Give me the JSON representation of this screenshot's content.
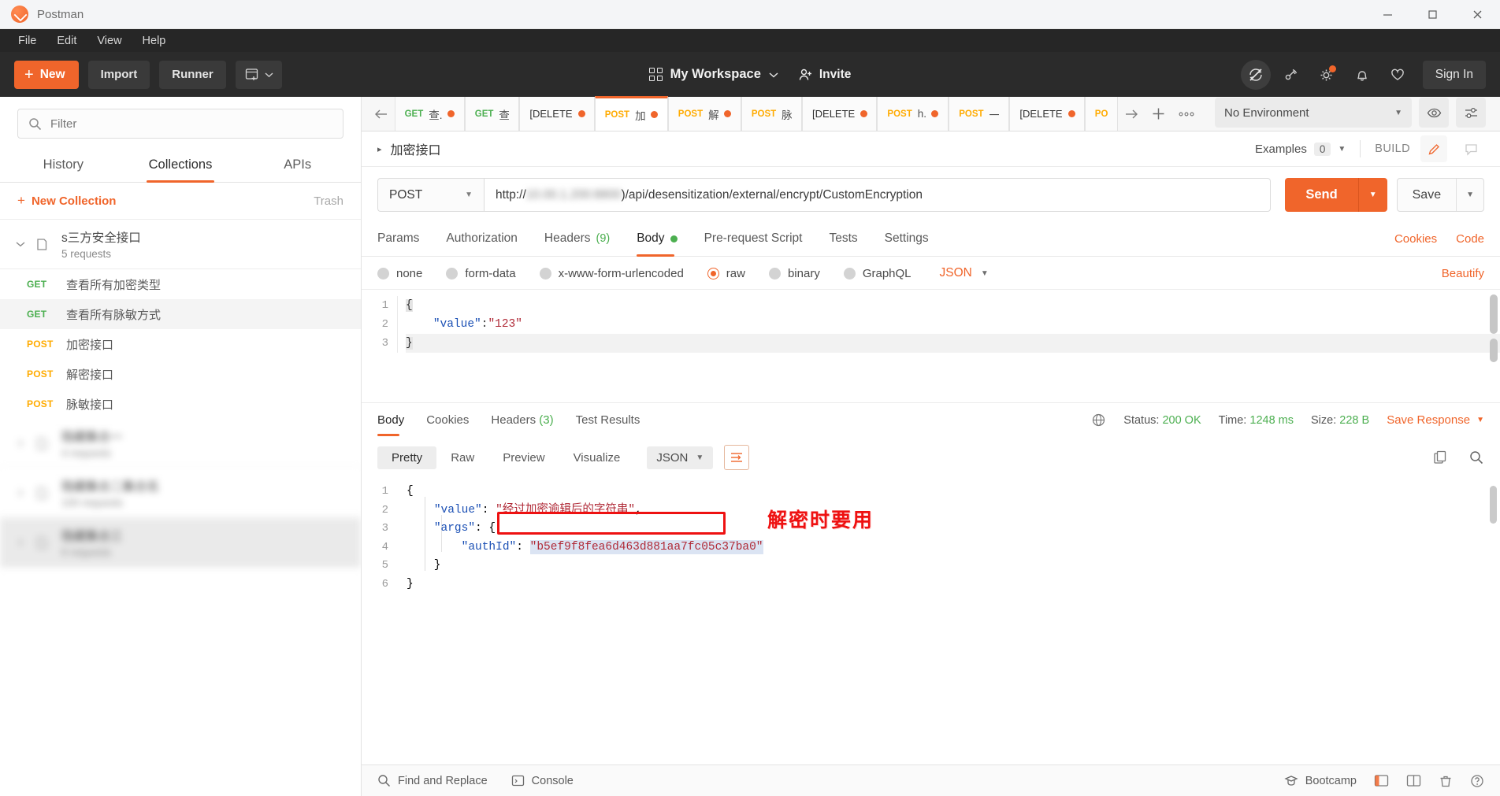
{
  "window": {
    "title": "Postman",
    "logo_icon": "postman-logo-icon",
    "minimize_label": "—",
    "maximize_label": "❐",
    "close_label": "✕"
  },
  "menubar": {
    "items": [
      "File",
      "Edit",
      "View",
      "Help"
    ]
  },
  "toolbar": {
    "new_label": "New",
    "new_plus": "+",
    "import_label": "Import",
    "runner_label": "Runner",
    "new_window_icon": "new-window-icon",
    "workspace_label": "My Workspace",
    "workspace_icon": "grid-icon",
    "invite_label": "Invite",
    "invite_icon": "person-add-icon",
    "sync_icon": "sync-off-icon",
    "satellite_icon": "satellite-icon",
    "gear_icon": "gear-icon",
    "bell_icon": "bell-icon",
    "heart_icon": "heart-icon",
    "signin_label": "Sign In",
    "accent": "#f0652b"
  },
  "sidebar": {
    "search": {
      "placeholder": "Filter",
      "value": "",
      "icon": "search-icon"
    },
    "tabs": [
      {
        "label": "History",
        "active": false
      },
      {
        "label": "Collections",
        "active": true
      },
      {
        "label": "APIs",
        "active": false
      }
    ],
    "new_collection_label": "New Collection",
    "new_collection_plus": "+",
    "trash_label": "Trash",
    "collection": {
      "name": "s三方安全接口",
      "sub": "5 requests",
      "chevron": "⌄",
      "folder_icon": "folder-icon"
    },
    "requests": [
      {
        "method": "GET",
        "name": "查看所有加密类型",
        "selected": false
      },
      {
        "method": "GET",
        "name": "查看所有脉敏方式",
        "selected": true
      },
      {
        "method": "POST",
        "name": "加密接口",
        "selected": false
      },
      {
        "method": "POST",
        "name": "解密接口",
        "selected": false
      },
      {
        "method": "POST",
        "name": "脉敏接口",
        "selected": false
      }
    ],
    "hidden_collections": [
      {
        "name": "隐藏集合一",
        "sub": "4 requests",
        "shaded": false
      },
      {
        "name": "隐藏集合二集合名",
        "sub": "100 requests",
        "shaded": false
      },
      {
        "name": "隐藏集合三",
        "sub": "6 requests",
        "shaded": true
      }
    ]
  },
  "tabstrip": {
    "scroll_left_icon": "arrow-left-icon",
    "scroll_right_icon": "arrow-right-icon",
    "add_tab_icon": "plus-icon",
    "more_icon": "ellipsis-icon",
    "tabs": [
      {
        "method": "GET",
        "title": "查.",
        "unsaved": true,
        "active": false
      },
      {
        "method": "GET",
        "title": "查",
        "unsaved": false,
        "active": false
      },
      {
        "method": "[DELETE",
        "title": "",
        "unsaved": true,
        "active": false
      },
      {
        "method": "POST",
        "title": "加",
        "unsaved": true,
        "active": true
      },
      {
        "method": "POST",
        "title": "解",
        "unsaved": true,
        "active": false
      },
      {
        "method": "POST",
        "title": "脉",
        "unsaved": false,
        "active": false
      },
      {
        "method": "[DELETE",
        "title": "",
        "unsaved": true,
        "active": false
      },
      {
        "method": "POST",
        "title": "h.",
        "unsaved": true,
        "active": false
      },
      {
        "method": "POST",
        "title": "一",
        "unsaved": false,
        "active": false
      },
      {
        "method": "[DELETE",
        "title": "",
        "unsaved": true,
        "active": false
      },
      {
        "method": "PO",
        "title": "",
        "unsaved": false,
        "active": false
      }
    ],
    "environment": {
      "selected": "No Environment",
      "chevron": "▼",
      "eye_icon": "eye-icon",
      "settings_icon": "sliders-icon"
    }
  },
  "request": {
    "name": "加密接口",
    "caret": "▸",
    "examples_label": "Examples",
    "examples_count": "0",
    "examples_chevron": "▼",
    "build_label": "BUILD",
    "edit_icon": "pencil-icon",
    "comment_icon": "comment-icon",
    "method": "POST",
    "method_chevron": "▼",
    "url_prefix": "http://",
    "url_host_hidden": "10.00.1.200:8800",
    "url_path": ")/api/desensitization/external/encrypt/CustomEncryption",
    "send_label": "Send",
    "send_chevron": "▼",
    "save_label": "Save",
    "save_chevron": "▼",
    "tabs": [
      {
        "label": "Params",
        "active": false,
        "count": "",
        "dot": false
      },
      {
        "label": "Authorization",
        "active": false,
        "count": "",
        "dot": false
      },
      {
        "label": "Headers",
        "active": false,
        "count": "(9)",
        "dot": false
      },
      {
        "label": "Body",
        "active": true,
        "count": "",
        "dot": true
      },
      {
        "label": "Pre-request Script",
        "active": false,
        "count": "",
        "dot": false
      },
      {
        "label": "Tests",
        "active": false,
        "count": "",
        "dot": false
      },
      {
        "label": "Settings",
        "active": false,
        "count": "",
        "dot": false
      }
    ],
    "cookies_link": "Cookies",
    "code_link": "Code",
    "body_types": [
      {
        "label": "none",
        "selected": false
      },
      {
        "label": "form-data",
        "selected": false
      },
      {
        "label": "x-www-form-urlencoded",
        "selected": false
      },
      {
        "label": "raw",
        "selected": true
      },
      {
        "label": "binary",
        "selected": false
      },
      {
        "label": "GraphQL",
        "selected": false
      }
    ],
    "raw_format": "JSON",
    "raw_format_chevron": "▼",
    "beautify_label": "Beautify",
    "body_lines": [
      {
        "n": "1",
        "text": "{",
        "kind": "brace"
      },
      {
        "n": "2",
        "text": "    \"value\":\"123\"",
        "kind": "kv"
      },
      {
        "n": "3",
        "text": "}",
        "kind": "brace"
      }
    ]
  },
  "response": {
    "tabs": [
      {
        "label": "Body",
        "active": true,
        "count": ""
      },
      {
        "label": "Cookies",
        "active": false,
        "count": ""
      },
      {
        "label": "Headers",
        "active": false,
        "count": "(3)"
      },
      {
        "label": "Test Results",
        "active": false,
        "count": ""
      }
    ],
    "globe_icon": "globe-icon",
    "status_label": "Status:",
    "status_value": "200 OK",
    "time_label": "Time:",
    "time_value": "1248 ms",
    "size_label": "Size:",
    "size_value": "228 B",
    "save_response_label": "Save Response",
    "save_response_chevron": "▼",
    "view_tabs": [
      {
        "label": "Pretty",
        "active": true
      },
      {
        "label": "Raw",
        "active": false
      },
      {
        "label": "Preview",
        "active": false
      },
      {
        "label": "Visualize",
        "active": false
      }
    ],
    "format": "JSON",
    "format_chevron": "▼",
    "wrap_icon": "word-wrap-icon",
    "copy_icon": "copy-icon",
    "search_icon": "search-icon",
    "lines": [
      {
        "n": "1",
        "segments": [
          {
            "t": "{",
            "c": "plain"
          }
        ]
      },
      {
        "n": "2",
        "segments": [
          {
            "t": "    ",
            "c": "plain"
          },
          {
            "t": "\"value\"",
            "c": "key"
          },
          {
            "t": ": ",
            "c": "plain"
          },
          {
            "t": "\"经过加密逾辑后的字符串\"",
            "c": "str"
          },
          {
            "t": ",",
            "c": "plain"
          }
        ]
      },
      {
        "n": "3",
        "segments": [
          {
            "t": "    ",
            "c": "plain"
          },
          {
            "t": "\"args\"",
            "c": "key"
          },
          {
            "t": ": {",
            "c": "plain"
          }
        ]
      },
      {
        "n": "4",
        "segments": [
          {
            "t": "        ",
            "c": "plain"
          },
          {
            "t": "\"authId\"",
            "c": "key"
          },
          {
            "t": ": ",
            "c": "plain"
          },
          {
            "t": "\"b5ef9f8fea6d463d881aa7fc05c37ba0\"",
            "c": "str-hl"
          }
        ]
      },
      {
        "n": "5",
        "segments": [
          {
            "t": "    }",
            "c": "plain"
          }
        ]
      },
      {
        "n": "6",
        "segments": [
          {
            "t": "}",
            "c": "plain"
          }
        ]
      }
    ],
    "annotation": "解密时要用",
    "annotation_color": "#ee1111",
    "highlight_box_color": "#ee1111"
  },
  "statusbar": {
    "find_replace_label": "Find and Replace",
    "find_icon": "search-icon",
    "console_label": "Console",
    "console_icon": "terminal-icon",
    "bootcamp_label": "Bootcamp",
    "bootcamp_icon": "bootcamp-icon",
    "layout_icon": "sidebar-layout-icon",
    "two_pane_icon": "two-pane-icon",
    "trash_icon": "trash-icon",
    "help_icon": "help-icon"
  }
}
